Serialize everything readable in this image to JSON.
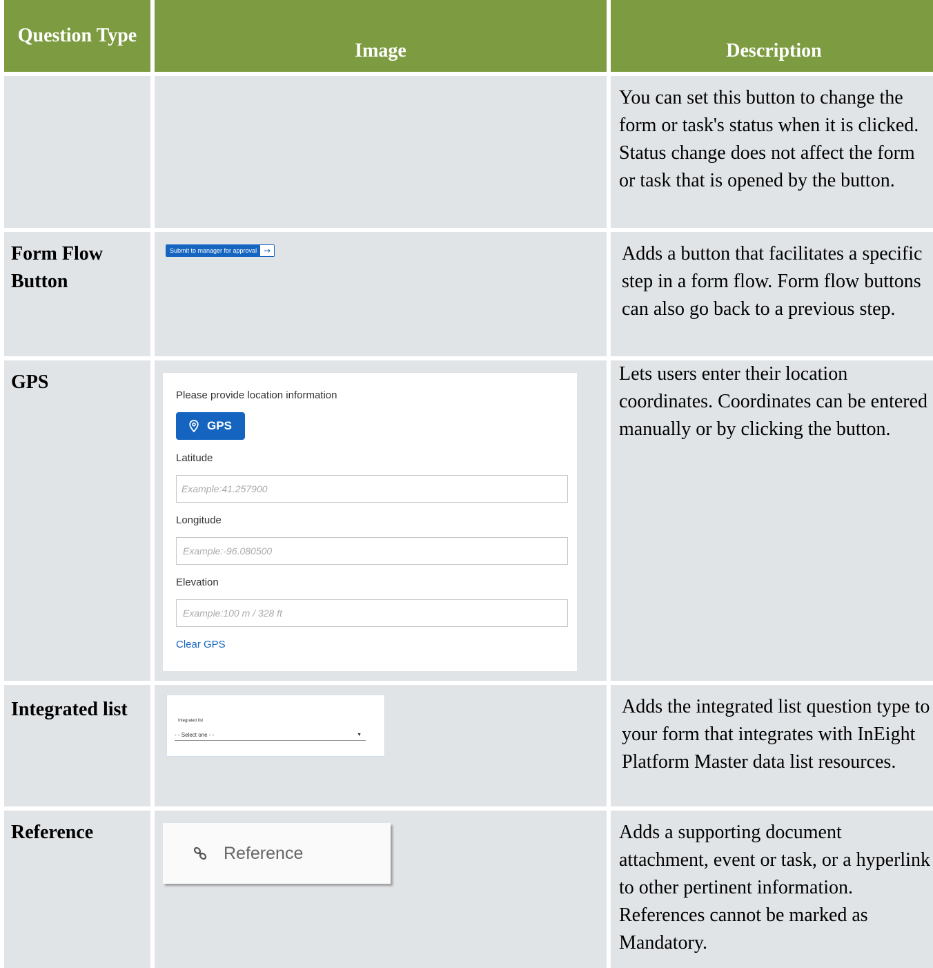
{
  "header": {
    "question_type": "Question Type",
    "image": "Image",
    "description": "Description"
  },
  "rows": [
    {
      "question_type": "",
      "description": "You can set this button to change the form or task's status when it is clicked. Status change does not affect the form or task that is opened by the button."
    },
    {
      "question_type": "Form Flow Button",
      "description": "Adds a button that facilitates a specific step in a form flow. Form flow buttons can also go back to a previous step.",
      "image": {
        "button_label": "Submit to manager for approval",
        "arrow_icon": "arrow-right-icon"
      }
    },
    {
      "question_type": "GPS",
      "description": "Lets users enter their location coordinates. Coordinates can be entered manually or by clicking the button.",
      "image": {
        "title": "Please provide location information",
        "gps_button": "GPS",
        "latitude_label": "Latitude",
        "latitude_placeholder": "Example:41.257900",
        "longitude_label": "Longitude",
        "longitude_placeholder": "Example:-96.080500",
        "elevation_label": "Elevation",
        "elevation_placeholder": "Example:100 m / 328 ft",
        "clear_link": "Clear GPS",
        "accent": "#1565c0"
      }
    },
    {
      "question_type": "Integrated list",
      "description": "Adds the integrated list question type to your form that integrates with InEight Platform Master data list resources.",
      "image": {
        "caption": "Integrated list",
        "select_value": "- - Select one - -"
      }
    },
    {
      "question_type": "Reference",
      "description": "Adds a supporting document attachment, event or task, or a hyperlink to other pertinent information. References cannot be marked as Mandatory.",
      "image": {
        "label": "Reference",
        "icon": "link-icon"
      }
    }
  ],
  "colors": {
    "header_bg": "#7d9b40",
    "cell_bg": "#e1e4e7"
  }
}
